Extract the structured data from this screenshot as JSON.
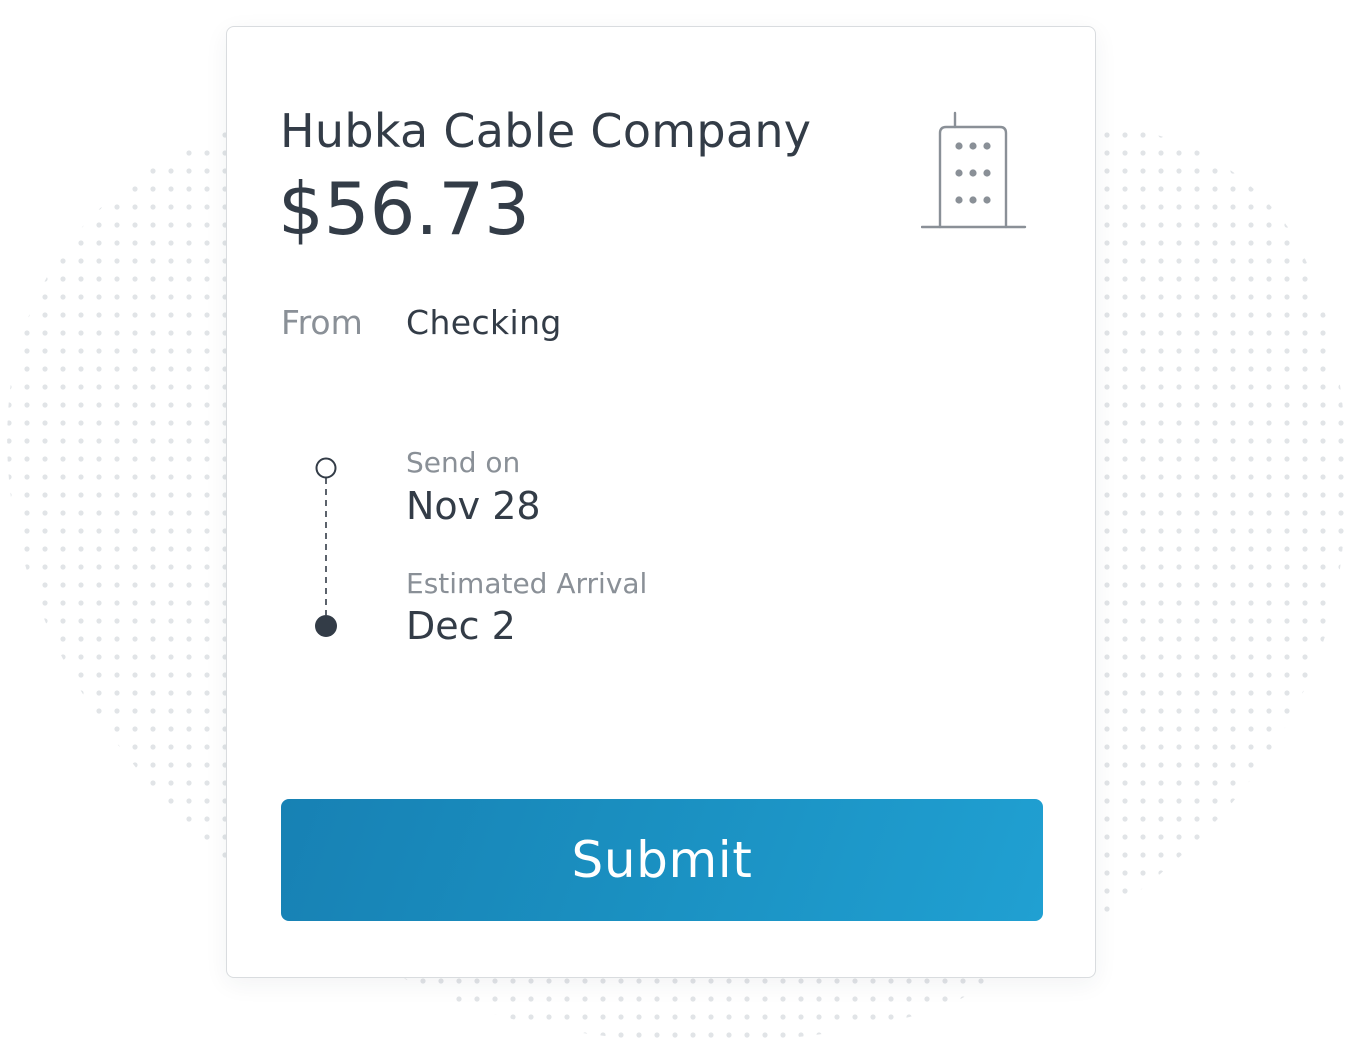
{
  "payment": {
    "payee": "Hubka Cable Company",
    "amount": "$56.73",
    "payee_icon": "building-icon",
    "from_label": "From",
    "from_account": "Checking"
  },
  "schedule": {
    "send_label": "Send on",
    "send_date": "Nov 28",
    "arrival_label": "Estimated Arrival",
    "arrival_date": "Dec 2"
  },
  "actions": {
    "submit_label": "Submit"
  },
  "colors": {
    "text_primary": "#333c47",
    "text_secondary": "#8a9097",
    "accent": "#1a8fc0",
    "dots": "#e1e4e7"
  }
}
